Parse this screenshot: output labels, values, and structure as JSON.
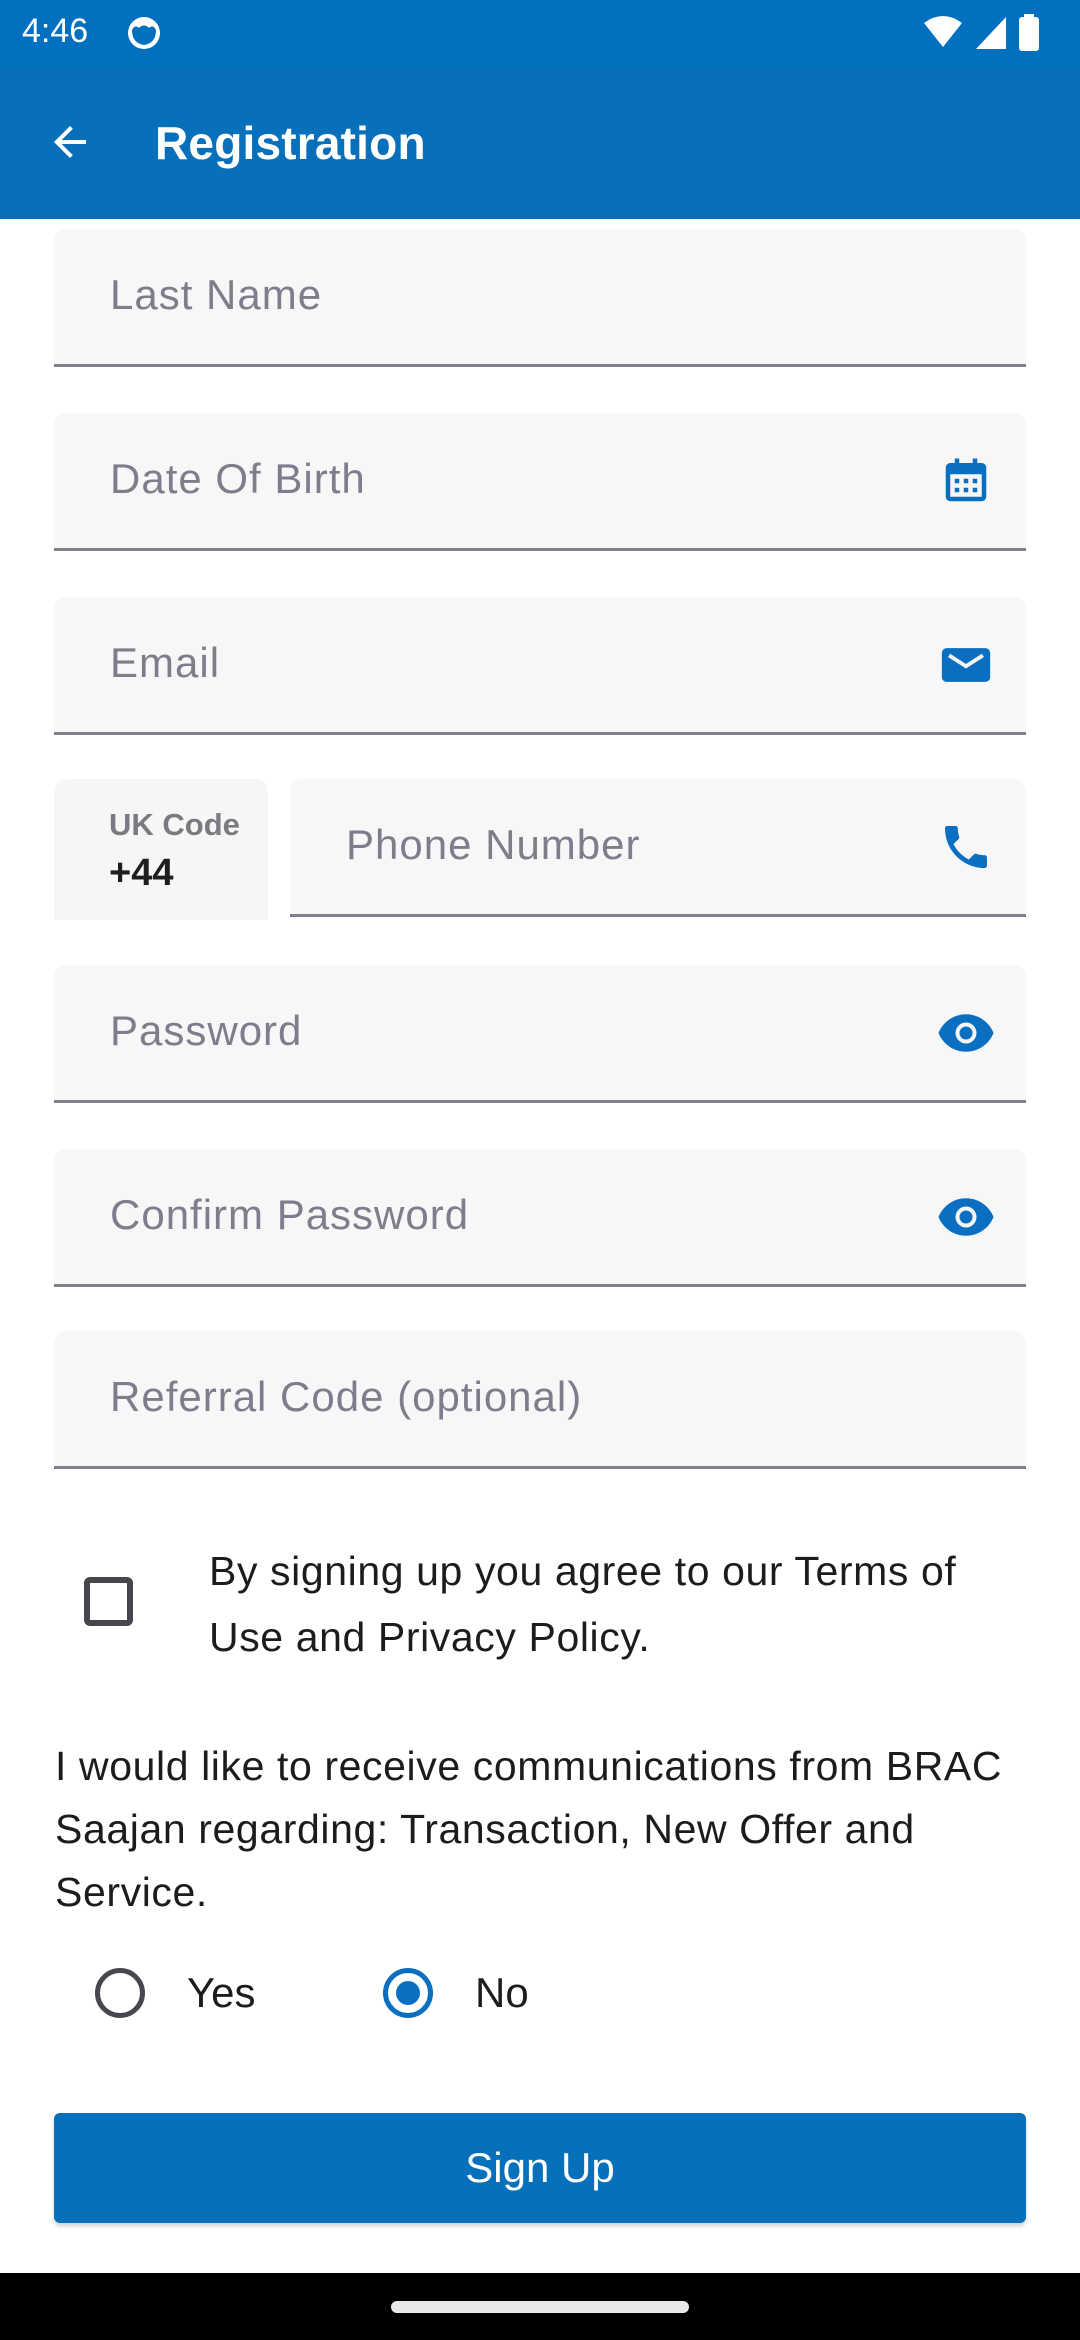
{
  "status_bar": {
    "time": "4:46",
    "icons": [
      "app-notification-icon",
      "wifi-icon",
      "cellular-signal-icon",
      "battery-icon"
    ]
  },
  "app_bar": {
    "title": "Registration",
    "back_icon": "arrow-left-icon"
  },
  "form": {
    "last_name": {
      "placeholder": "Last Name",
      "value": ""
    },
    "date_of_birth": {
      "placeholder": "Date Of Birth",
      "value": "",
      "icon": "calendar-icon"
    },
    "email": {
      "placeholder": "Email",
      "value": "",
      "icon": "mail-icon"
    },
    "country_code": {
      "label": "UK Code",
      "value": "+44"
    },
    "phone": {
      "placeholder": "Phone Number",
      "value": "",
      "icon": "phone-icon"
    },
    "password": {
      "placeholder": "Password",
      "value": "",
      "icon": "eye-icon"
    },
    "confirm_password": {
      "placeholder": "Confirm Password",
      "value": "",
      "icon": "eye-icon"
    },
    "referral_code": {
      "placeholder": "Referral Code (optional)",
      "value": ""
    }
  },
  "terms": {
    "checked": false,
    "text": "By signing up you agree to our Terms of Use and Privacy Policy."
  },
  "communications": {
    "text": "I would like to receive communications from BRAC Saajan regarding: Transaction, New Offer and Service.",
    "options": [
      {
        "label": "Yes",
        "selected": false
      },
      {
        "label": "No",
        "selected": true
      }
    ]
  },
  "signup_button": {
    "label": "Sign Up"
  },
  "colors": {
    "primary": "#0670bb",
    "field_background": "#f7f7f8",
    "placeholder": "#7f7d8b",
    "underline": "#807f8c"
  }
}
